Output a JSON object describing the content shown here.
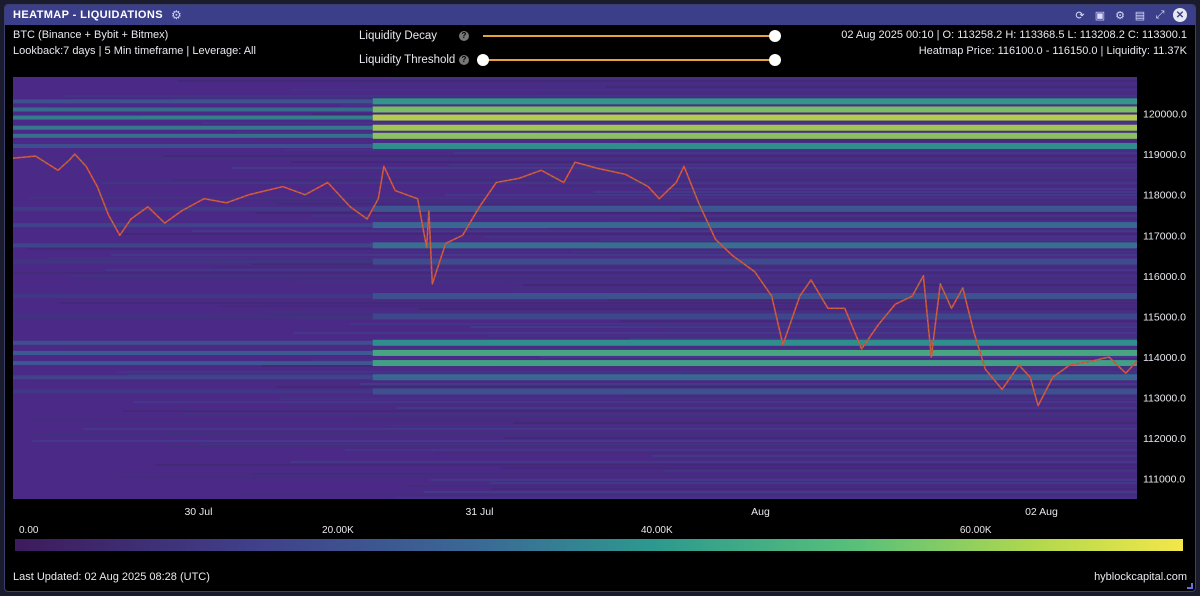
{
  "window": {
    "title": "HEATMAP - LIQUIDATIONS",
    "icons": [
      "refresh-icon",
      "camera-icon",
      "gear-icon",
      "save-icon",
      "expand-icon",
      "close-icon"
    ]
  },
  "info": {
    "exchanges": "BTC (Binance + Bybit + Bitmex)",
    "lookback": "Lookback:7 days | 5 Min timeframe | Leverage: All",
    "ohlc": "02 Aug 2025 00:10 | O: 113258.2 H: 113368.5 L: 113208.2 C: 113300.1",
    "heatmap_price": "Heatmap Price: 116100.0 - 116150.0 | Liquidity: 11.37K"
  },
  "controls": {
    "liquidity_decay": {
      "label": "Liquidity Decay",
      "value": 1.0
    },
    "liquidity_threshold": {
      "label": "Liquidity Threshold",
      "low": 0.0,
      "high": 1.0
    }
  },
  "chart_data": {
    "type": "heatmap",
    "x_ticks": [
      "30 Jul",
      "31 Jul",
      "Aug",
      "02 Aug"
    ],
    "y_ticks": [
      "111000.0",
      "112000.0",
      "113000.0",
      "114000.0",
      "115000.0",
      "116000.0",
      "117000.0",
      "118000.0",
      "119000.0",
      "120000.0"
    ],
    "ylim": [
      110500,
      120900
    ],
    "colorbar_ticks": [
      "0.00",
      "20.00K",
      "40.00K",
      "60.00K"
    ],
    "colorbar_range": [
      0,
      73000
    ],
    "price_series": [
      {
        "t": 0.0,
        "p": 118900
      },
      {
        "t": 0.02,
        "p": 118950
      },
      {
        "t": 0.04,
        "p": 118600
      },
      {
        "t": 0.05,
        "p": 118850
      },
      {
        "t": 0.055,
        "p": 119000
      },
      {
        "t": 0.065,
        "p": 118700
      },
      {
        "t": 0.075,
        "p": 118200
      },
      {
        "t": 0.085,
        "p": 117500
      },
      {
        "t": 0.095,
        "p": 117000
      },
      {
        "t": 0.105,
        "p": 117400
      },
      {
        "t": 0.12,
        "p": 117700
      },
      {
        "t": 0.135,
        "p": 117300
      },
      {
        "t": 0.15,
        "p": 117600
      },
      {
        "t": 0.17,
        "p": 117900
      },
      {
        "t": 0.19,
        "p": 117800
      },
      {
        "t": 0.21,
        "p": 118000
      },
      {
        "t": 0.24,
        "p": 118200
      },
      {
        "t": 0.26,
        "p": 118000
      },
      {
        "t": 0.28,
        "p": 118300
      },
      {
        "t": 0.3,
        "p": 117700
      },
      {
        "t": 0.315,
        "p": 117400
      },
      {
        "t": 0.325,
        "p": 117900
      },
      {
        "t": 0.33,
        "p": 118700
      },
      {
        "t": 0.34,
        "p": 118100
      },
      {
        "t": 0.36,
        "p": 117900
      },
      {
        "t": 0.37,
        "p": 117600
      },
      {
        "t": 0.368,
        "p": 116700
      },
      {
        "t": 0.373,
        "p": 115800
      },
      {
        "t": 0.385,
        "p": 116800
      },
      {
        "t": 0.4,
        "p": 117000
      },
      {
        "t": 0.415,
        "p": 117700
      },
      {
        "t": 0.43,
        "p": 118300
      },
      {
        "t": 0.45,
        "p": 118400
      },
      {
        "t": 0.47,
        "p": 118600
      },
      {
        "t": 0.49,
        "p": 118300
      },
      {
        "t": 0.5,
        "p": 118800
      },
      {
        "t": 0.52,
        "p": 118650
      },
      {
        "t": 0.545,
        "p": 118500
      },
      {
        "t": 0.565,
        "p": 118200
      },
      {
        "t": 0.575,
        "p": 117900
      },
      {
        "t": 0.59,
        "p": 118300
      },
      {
        "t": 0.597,
        "p": 118700
      },
      {
        "t": 0.61,
        "p": 117800
      },
      {
        "t": 0.625,
        "p": 116900
      },
      {
        "t": 0.64,
        "p": 116500
      },
      {
        "t": 0.66,
        "p": 116100
      },
      {
        "t": 0.675,
        "p": 115500
      },
      {
        "t": 0.685,
        "p": 114300
      },
      {
        "t": 0.7,
        "p": 115500
      },
      {
        "t": 0.71,
        "p": 115900
      },
      {
        "t": 0.725,
        "p": 115200
      },
      {
        "t": 0.74,
        "p": 115200
      },
      {
        "t": 0.755,
        "p": 114200
      },
      {
        "t": 0.77,
        "p": 114800
      },
      {
        "t": 0.785,
        "p": 115300
      },
      {
        "t": 0.8,
        "p": 115500
      },
      {
        "t": 0.81,
        "p": 116000
      },
      {
        "t": 0.817,
        "p": 114000
      },
      {
        "t": 0.825,
        "p": 115800
      },
      {
        "t": 0.835,
        "p": 115200
      },
      {
        "t": 0.845,
        "p": 115700
      },
      {
        "t": 0.855,
        "p": 114600
      },
      {
        "t": 0.865,
        "p": 113700
      },
      {
        "t": 0.88,
        "p": 113200
      },
      {
        "t": 0.895,
        "p": 113800
      },
      {
        "t": 0.905,
        "p": 113500
      },
      {
        "t": 0.912,
        "p": 112800
      },
      {
        "t": 0.925,
        "p": 113500
      },
      {
        "t": 0.94,
        "p": 113800
      },
      {
        "t": 0.96,
        "p": 113900
      },
      {
        "t": 0.975,
        "p": 114000
      },
      {
        "t": 0.99,
        "p": 113600
      },
      {
        "t": 1.0,
        "p": 113900
      }
    ],
    "liquidity_bands": [
      {
        "p": 120300,
        "v": 42000
      },
      {
        "p": 120100,
        "v": 58000
      },
      {
        "p": 119900,
        "v": 66000
      },
      {
        "p": 119650,
        "v": 63000
      },
      {
        "p": 119450,
        "v": 60000
      },
      {
        "p": 119200,
        "v": 40000
      },
      {
        "p": 117650,
        "v": 24000
      },
      {
        "p": 117250,
        "v": 30000
      },
      {
        "p": 116750,
        "v": 32000
      },
      {
        "p": 116350,
        "v": 20000
      },
      {
        "p": 115500,
        "v": 22000
      },
      {
        "p": 115000,
        "v": 18000
      },
      {
        "p": 114350,
        "v": 40000
      },
      {
        "p": 114100,
        "v": 48000
      },
      {
        "p": 113850,
        "v": 46000
      },
      {
        "p": 113500,
        "v": 30000
      },
      {
        "p": 113150,
        "v": 22000
      }
    ]
  },
  "footer": {
    "last_updated": "Last Updated: 02 Aug 2025 08:28 (UTC)",
    "brand": "hyblockcapital.com"
  }
}
